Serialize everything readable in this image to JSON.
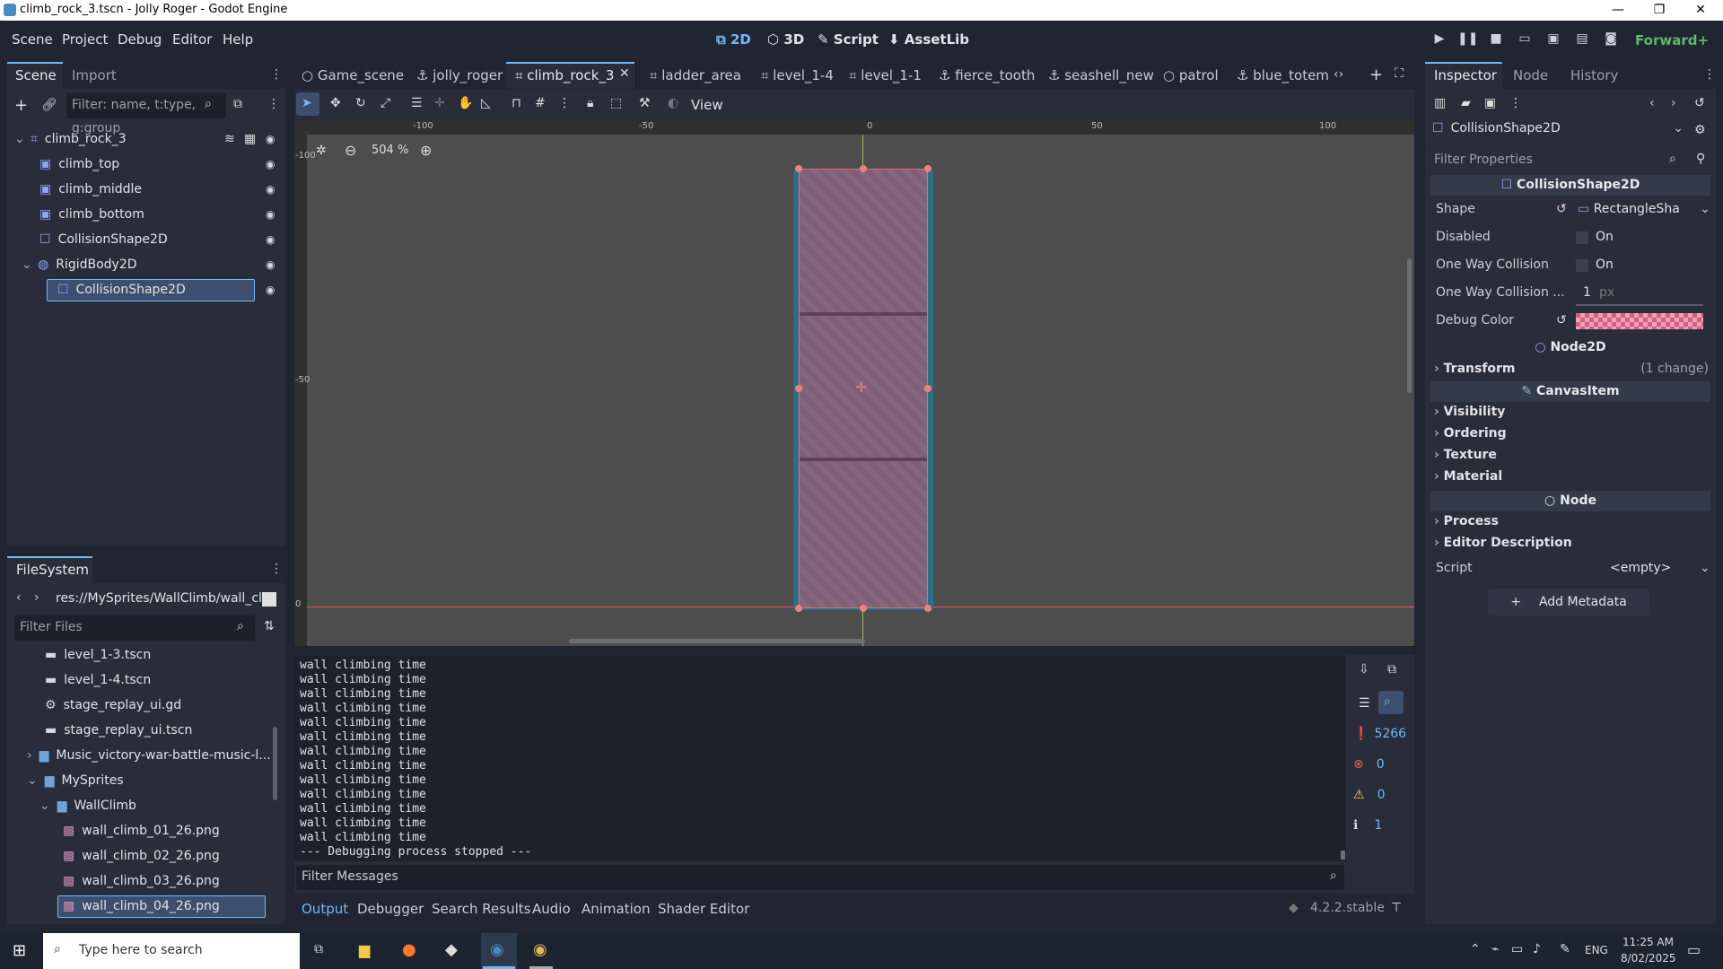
{
  "window": {
    "title": "climb_rock_3.tscn - Jolly Roger - Godot Engine",
    "min": "—",
    "max": "❐",
    "close": "✕"
  },
  "menus": [
    "Scene",
    "Project",
    "Debug",
    "Editor",
    "Help"
  ],
  "modes": [
    "2D",
    "3D",
    "Script",
    "AssetLib"
  ],
  "renderer": "Forward+",
  "scene_dock": {
    "tabs": [
      "Scene",
      "Import"
    ],
    "filter_placeholder": "Filter: name, t:type, g:group",
    "nodes": [
      {
        "label": "climb_rock_3"
      },
      {
        "label": "climb_top"
      },
      {
        "label": "climb_middle"
      },
      {
        "label": "climb_bottom"
      },
      {
        "label": "CollisionShape2D"
      },
      {
        "label": "RigidBody2D"
      },
      {
        "label": "CollisionShape2D"
      }
    ]
  },
  "filesystem": {
    "title": "FileSystem",
    "path": "res://MySprites/WallClimb/wall_cli",
    "filter_placeholder": "Filter Files",
    "items": [
      {
        "label": "level_1-3.tscn"
      },
      {
        "label": "level_1-4.tscn"
      },
      {
        "label": "stage_replay_ui.gd"
      },
      {
        "label": "stage_replay_ui.tscn"
      },
      {
        "label": "Music_victory-war-battle-music-l..."
      },
      {
        "label": "MySprites"
      },
      {
        "label": "WallClimb"
      },
      {
        "label": "wall_climb_01_26.png"
      },
      {
        "label": "wall_climb_02_26.png"
      },
      {
        "label": "wall_climb_03_26.png"
      },
      {
        "label": "wall_climb_04_26.png"
      }
    ]
  },
  "editor_tabs": [
    "Game_scene",
    "jolly_roger",
    "climb_rock_3",
    "ladder_area",
    "level_1-4",
    "level_1-1",
    "fierce_tooth",
    "seashell_new",
    "patrol",
    "blue_totem"
  ],
  "viewport": {
    "view_label": "View",
    "zoom": "504 %",
    "ruler_labels": [
      "-100",
      "-50",
      "0",
      "50",
      "100"
    ],
    "vruler_labels": [
      "-100",
      "-50",
      "0"
    ]
  },
  "console": {
    "lines": [
      "wall climbing time",
      "wall climbing time",
      "wall climbing time",
      "wall climbing time",
      "wall climbing time",
      "wall climbing time",
      "wall climbing time",
      "wall climbing time",
      "wall climbing time",
      "wall climbing time",
      "wall climbing time",
      "wall climbing time",
      "wall climbing time",
      "--- Debugging process stopped ---"
    ],
    "filter_placeholder": "Filter Messages",
    "count_messages": "5266",
    "count_errors": "0",
    "count_warnings": "0",
    "count_info": "1"
  },
  "bottom_tabs": [
    "Output",
    "Debugger",
    "Search Results",
    "Audio",
    "Animation",
    "Shader Editor"
  ],
  "version": "4.2.2.stable",
  "inspector": {
    "tabs": [
      "Inspector",
      "Node",
      "History"
    ],
    "object": "CollisionShape2D",
    "filter_placeholder": "Filter Properties",
    "class_header": "CollisionShape2D",
    "props": {
      "shape_label": "Shape",
      "shape_value": "RectangleSha",
      "disabled_label": "Disabled",
      "disabled_value": "On",
      "oneway_label": "One Way Collision",
      "oneway_value": "On",
      "margin_label": "One Way Collision ...",
      "margin_value": "1",
      "margin_unit": "px",
      "debug_label": "Debug Color"
    },
    "node2d_header": "Node2D",
    "transform": "Transform",
    "transform_note": "(1 change)",
    "canvas_header": "CanvasItem",
    "canvas_sections": [
      "Visibility",
      "Ordering",
      "Texture",
      "Material"
    ],
    "node_header": "Node",
    "node_sections": [
      "Process",
      "Editor Description"
    ],
    "script_label": "Script",
    "script_value": "<empty>",
    "add_metadata": "Add Metadata"
  },
  "taskbar": {
    "search_placeholder": "Type here to search",
    "lang": "ENG",
    "time": "11:25 AM",
    "date": "8/02/2025"
  },
  "colors": {
    "accent": "#70bafa",
    "background": "#202531",
    "panel": "#282d39",
    "canvas": "#4d4d4d",
    "rock": "#7a5b74",
    "collision": "#2a6f86"
  }
}
